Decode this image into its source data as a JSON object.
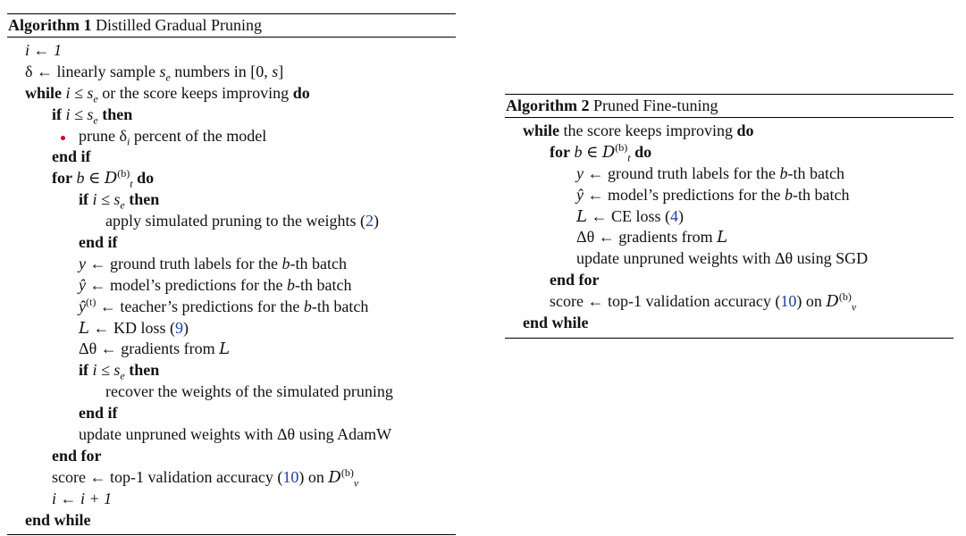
{
  "algorithm1": {
    "label": "Algorithm 1",
    "name": "Distilled Gradual Pruning",
    "lines": [
      {
        "a": "i ← 1"
      },
      {
        "a": "δ ← linearly sample ",
        "b": "s",
        "c": "e",
        "d": " numbers in [0, ",
        "e": "s",
        "f": "]"
      },
      {
        "kw1": "while",
        "a": " i ≤ s",
        "sub": "e",
        "b": " or the score keeps improving ",
        "kw2": "do"
      },
      {
        "kw1": "if",
        "a": " i ≤ s",
        "sub": "e",
        "kw2": " then"
      },
      {
        "a": "prune δ",
        "sub": "i",
        "b": " percent of the model"
      },
      {
        "kw1": "end if"
      },
      {
        "kw1": "for",
        "a": " b ∈ ",
        "cal": "D",
        "sup": "(b)",
        "sub": "t",
        "kw2": " do"
      },
      {
        "kw1": "if",
        "a": " i ≤ s",
        "sub": "e",
        "kw2": " then"
      },
      {
        "a": "apply simulated pruning to the weights (",
        "ref": "2",
        "b": ")"
      },
      {
        "kw1": "end if"
      },
      {
        "m": "y",
        "a": " ← ground truth labels for the ",
        "m2": "b",
        "b": "-th batch"
      },
      {
        "m": "ŷ",
        "a": " ← model’s predictions for the ",
        "m2": "b",
        "b": "-th batch"
      },
      {
        "m": "ŷ",
        "sup": "(t)",
        "a": " ← teacher’s predictions for the ",
        "m2": "b",
        "b": "-th batch"
      },
      {
        "cal": "L",
        "a": " ← KD loss (",
        "ref": "9",
        "b": ")"
      },
      {
        "a": "Δθ ← gradients from ",
        "cal": "L"
      },
      {
        "kw1": "if",
        "a": " i ≤ s",
        "sub": "e",
        "kw2": " then"
      },
      {
        "a": "recover the weights of the simulated pruning"
      },
      {
        "kw1": "end if"
      },
      {
        "a": "update unpruned weights with Δθ using AdamW"
      },
      {
        "kw1": "end for"
      },
      {
        "a": "score ← top-1 validation accuracy (",
        "ref": "10",
        "b": ") on ",
        "cal": "D",
        "sup": "(b)",
        "sub": "v"
      },
      {
        "a": "i ← i + 1"
      },
      {
        "kw1": "end while"
      }
    ]
  },
  "algorithm2": {
    "label": "Algorithm 2",
    "name": "Pruned Fine-tuning",
    "lines": [
      {
        "kw1": "while",
        "a": " the score keeps improving ",
        "kw2": "do"
      },
      {
        "kw1": "for",
        "a": " b ∈ ",
        "cal": "D",
        "sup": "(b)",
        "sub": "t",
        "kw2": " do"
      },
      {
        "m": "y",
        "a": " ← ground truth labels for the ",
        "m2": "b",
        "b": "-th batch"
      },
      {
        "m": "ŷ",
        "a": " ← model’s predictions for the ",
        "m2": "b",
        "b": "-th batch"
      },
      {
        "cal": "L",
        "a": " ← CE loss (",
        "ref": "4",
        "b": ")"
      },
      {
        "a": "Δθ ← gradients from ",
        "cal": "L"
      },
      {
        "a": "update unpruned weights with Δθ using SGD"
      },
      {
        "kw1": "end for"
      },
      {
        "a": "score ← top-1 validation accuracy (",
        "ref": "10",
        "b": ") on ",
        "cal": "D",
        "sup": "(b)",
        "sub": "v"
      },
      {
        "kw1": "end while"
      }
    ]
  },
  "colors": {
    "reference_link": "#1f3fa8",
    "marker_dot": "#d0021b"
  }
}
